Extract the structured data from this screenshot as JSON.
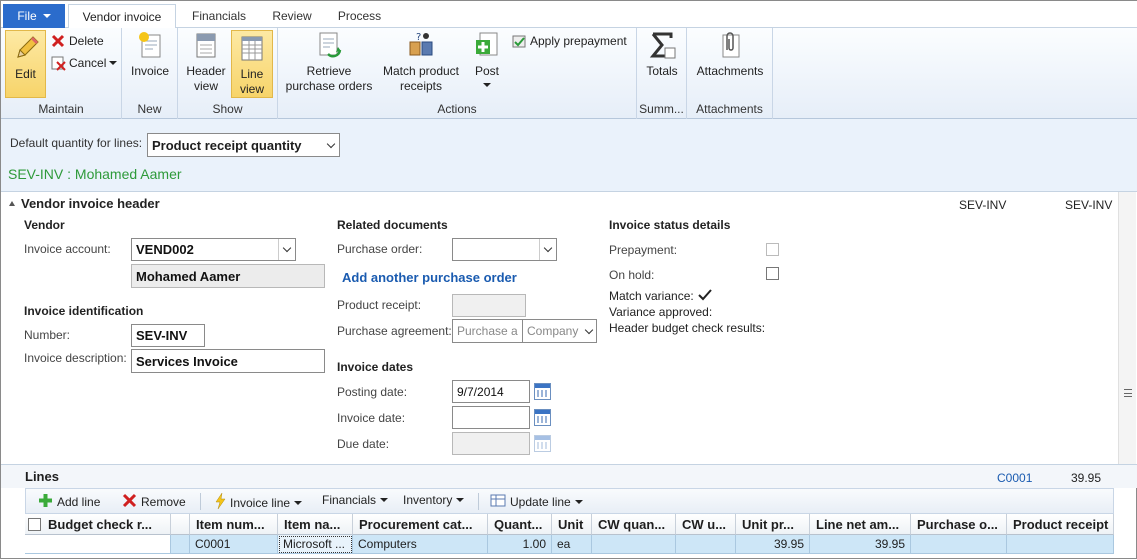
{
  "tabs": {
    "file": "File",
    "items": [
      "Vendor invoice",
      "Financials",
      "Review",
      "Process"
    ],
    "active": "Vendor invoice"
  },
  "ribbon": {
    "groups": {
      "maintain": "Maintain",
      "new": "New",
      "show": "Show",
      "actions": "Actions",
      "summary": "Summ...",
      "attachments": "Attachments"
    },
    "edit": "Edit",
    "delete": "Delete",
    "cancel": "Cancel",
    "invoice": "Invoice",
    "header_view_1": "Header",
    "header_view_2": "view",
    "line_view_1": "Line",
    "line_view_2": "view",
    "retrieve_1": "Retrieve",
    "retrieve_2": "purchase orders",
    "match_1": "Match product",
    "match_2": "receipts",
    "post": "Post",
    "apply_prepayment": "Apply prepayment",
    "totals": "Totals",
    "attachments": "Attachments"
  },
  "quantity_bar": {
    "label": "Default quantity for lines:",
    "value": "Product receipt quantity"
  },
  "record_title": "SEV-INV : Mohamed Aamer",
  "header": {
    "title": "Vendor invoice header",
    "right_1": "SEV-INV",
    "right_2": "SEV-INV",
    "vendor": {
      "section": "Vendor",
      "invoice_account_label": "Invoice account:",
      "invoice_account": "VEND002",
      "vendor_name": "Mohamed Aamer"
    },
    "identification": {
      "section": "Invoice identification",
      "number_label": "Number:",
      "number": "SEV-INV",
      "description_label": "Invoice description:",
      "description": "Services Invoice"
    },
    "related": {
      "section": "Related documents",
      "purchase_order_label": "Purchase order:",
      "purchase_order": "",
      "add_po_link": "Add another purchase order",
      "product_receipt_label": "Product receipt:",
      "purchase_agreement_label": "Purchase agreement:",
      "agreement_placeholder_1": "Purchase a",
      "agreement_placeholder_2": "Company"
    },
    "dates": {
      "section": "Invoice dates",
      "posting_label": "Posting date:",
      "posting": "9/7/2014",
      "invoice_label": "Invoice date:",
      "invoice": "",
      "due_label": "Due date:",
      "due": ""
    },
    "status": {
      "section": "Invoice status details",
      "prepayment_label": "Prepayment:",
      "on_hold_label": "On hold:",
      "match_variance_label": "Match variance:",
      "match_variance_icon": "checkmark",
      "variance_approved_label": "Variance approved:",
      "budget_label": "Header budget check results:"
    }
  },
  "lines": {
    "title": "Lines",
    "summary_code": "C0001",
    "summary_amount": "39.95",
    "toolbar": {
      "add_line": "Add line",
      "remove": "Remove",
      "invoice_line": "Invoice line",
      "financials": "Financials",
      "inventory": "Inventory",
      "update_line": "Update line"
    },
    "columns": [
      "Budget check r...",
      "",
      "Item num...",
      "Item na...",
      "Procurement cat...",
      "Quant...",
      "Unit",
      "CW quan...",
      "CW u...",
      "Unit pr...",
      "Line net am...",
      "Purchase o...",
      "Product receipt"
    ],
    "rows": [
      [
        "",
        "",
        "C0001",
        "Microsoft ...",
        "Computers",
        "1.00",
        "ea",
        "",
        "",
        "39.95",
        "39.95",
        "",
        ""
      ]
    ]
  },
  "colors": {
    "accent": "#2b6ccc",
    "record_title": "#2e9a3a",
    "link": "#1a5bb0",
    "selected_row": "#cde6f7",
    "selected_button": "#f7d46a"
  }
}
